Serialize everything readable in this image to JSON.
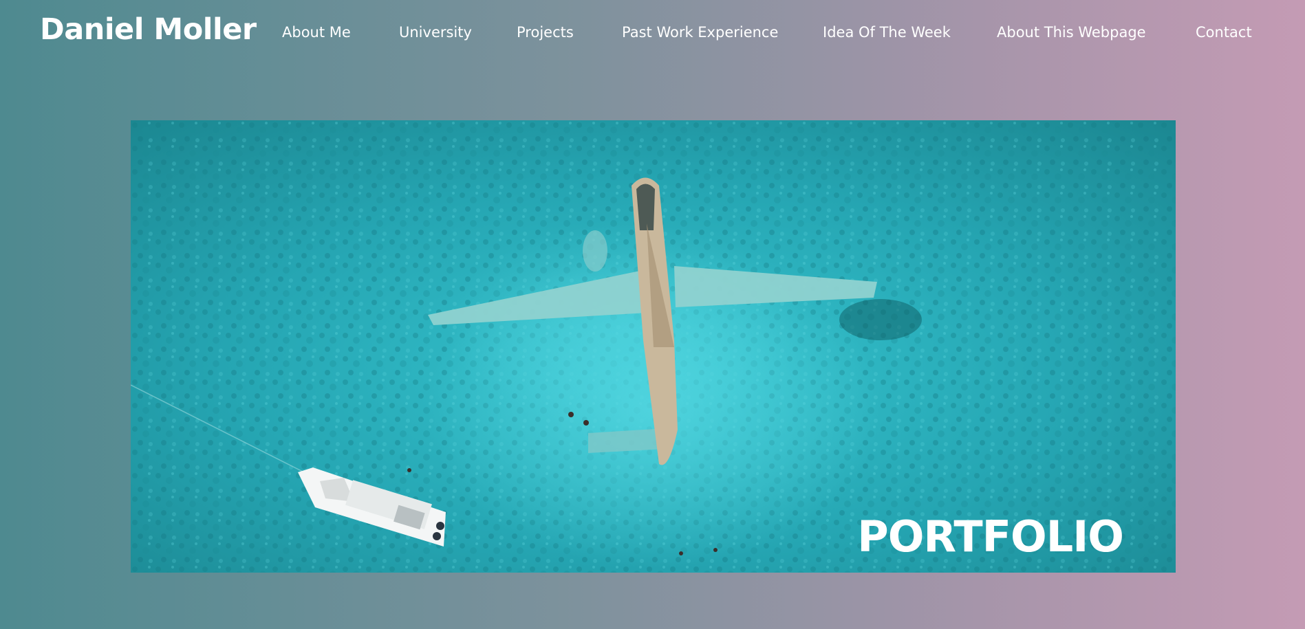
{
  "header": {
    "brand": "Daniel Moller"
  },
  "nav": {
    "items": [
      {
        "label": "About Me"
      },
      {
        "label": "University"
      },
      {
        "label": "Projects"
      },
      {
        "label": "Past Work Experience"
      },
      {
        "label": "Idea Of The Week"
      },
      {
        "label": "About This Webpage"
      },
      {
        "label": "Contact"
      }
    ]
  },
  "hero": {
    "title": "PORTFOLIO",
    "image_subject": "aerial-shipwreck-plane-photo"
  },
  "colors": {
    "gradient_left": "#4e8a90",
    "gradient_right": "#c49bb4",
    "water": "#2fb4c0",
    "text": "#ffffff"
  }
}
